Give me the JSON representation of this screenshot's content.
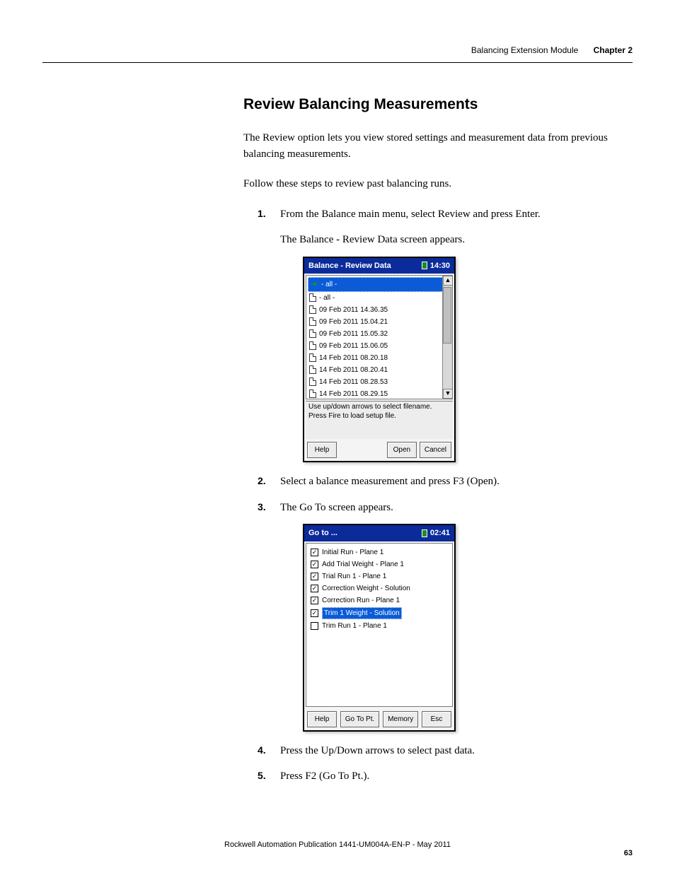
{
  "header": {
    "section": "Balancing Extension Module",
    "chapter": "Chapter 2"
  },
  "title": "Review Balancing Measurements",
  "intro": "The Review option lets you view stored settings and measurement data from previous balancing measurements.",
  "follow": "Follow these steps to review past balancing runs.",
  "steps": {
    "s1_num": "1.",
    "s1": "From the Balance main menu, select Review and press Enter.",
    "s1_sub": "The Balance - Review Data screen appears.",
    "s2_num": "2.",
    "s2": "Select a balance measurement and press F3 (Open).",
    "s3_num": "3.",
    "s3": "The Go To screen appears.",
    "s4_num": "4.",
    "s4": "Press the Up/Down arrows to select past data.",
    "s5_num": "5.",
    "s5": "Press F2 (Go To Pt.)."
  },
  "device1": {
    "title": "Balance - Review Data",
    "time": "14:30",
    "items": {
      "i0": "- all -",
      "i1": "- all -",
      "i2": "09 Feb 2011 14.36.35",
      "i3": "09 Feb 2011 15.04.21",
      "i4": "09 Feb 2011 15.05.32",
      "i5": "09 Feb 2011 15.06.05",
      "i6": "14 Feb 2011 08.20.18",
      "i7": "14 Feb 2011 08.20.41",
      "i8": "14 Feb 2011 08.28.53",
      "i9": "14 Feb 2011 08.29.15"
    },
    "hint1": "Use up/down arrows to select filename.",
    "hint2": "Press Fire to load setup file.",
    "buttons": {
      "help": "Help",
      "open": "Open",
      "cancel": "Cancel"
    }
  },
  "device2": {
    "title": "Go to ...",
    "time": "02:41",
    "items": {
      "i0": "Initial Run - Plane 1",
      "i1": "Add Trial Weight - Plane 1",
      "i2": "Trial Run 1 - Plane 1",
      "i3": "Correction Weight - Solution",
      "i4": "Correction Run - Plane 1",
      "i5": "Trim 1 Weight  - Solution",
      "i6": "Trim Run 1 - Plane 1"
    },
    "buttons": {
      "help": "Help",
      "goto": "Go To Pt.",
      "memory": "Memory",
      "esc": "Esc"
    }
  },
  "footer": {
    "pub": "Rockwell Automation Publication 1441-UM004A-EN-P - May 2011",
    "page": "63"
  }
}
